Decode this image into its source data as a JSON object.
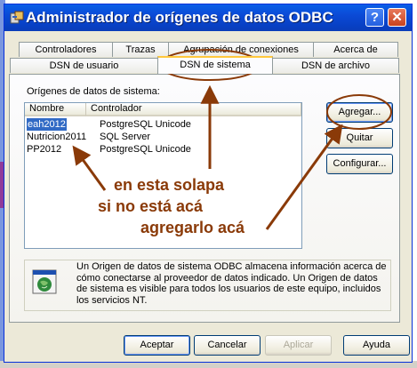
{
  "window": {
    "title": "Administrador de orígenes de datos ODBC",
    "help_glyph": "?",
    "close_glyph": "✕"
  },
  "tabs_back": [
    "Controladores",
    "Trazas",
    "Agrupación de conexiones",
    "Acerca de"
  ],
  "tabs_front": [
    "DSN de usuario",
    "DSN de sistema",
    "DSN de archivo"
  ],
  "active_tab": "DSN de sistema",
  "section_label": "Orígenes de datos de sistema:",
  "list": {
    "columns": [
      "Nombre",
      "Controlador"
    ],
    "rows": [
      {
        "name": "eah2012",
        "driver": "PostgreSQL Unicode",
        "selected": true
      },
      {
        "name": "Nutricion2011",
        "driver": "SQL Server",
        "selected": false
      },
      {
        "name": "PP2012",
        "driver": "PostgreSQL Unicode",
        "selected": false
      }
    ]
  },
  "side_buttons": {
    "add": "Agregar...",
    "remove": "Quitar",
    "configure": "Configurar..."
  },
  "info_text": "Un Origen de datos de sistema ODBC almacena información acerca de cómo conectarse al proveedor de datos indicado. Un Origen de datos de sistema es visible para todos los usuarios de este equipo, incluidos los servicios NT.",
  "bottom_buttons": {
    "ok": "Aceptar",
    "cancel": "Cancelar",
    "apply": "Aplicar",
    "help": "Ayuda"
  },
  "annotations": {
    "line1": "en esta solapa",
    "line2": "si no está acá",
    "line3": "agregarlo acá"
  },
  "colors": {
    "titlebar": "#0a5fe8",
    "annotation": "#8a3a08",
    "selection": "#316ac5"
  }
}
